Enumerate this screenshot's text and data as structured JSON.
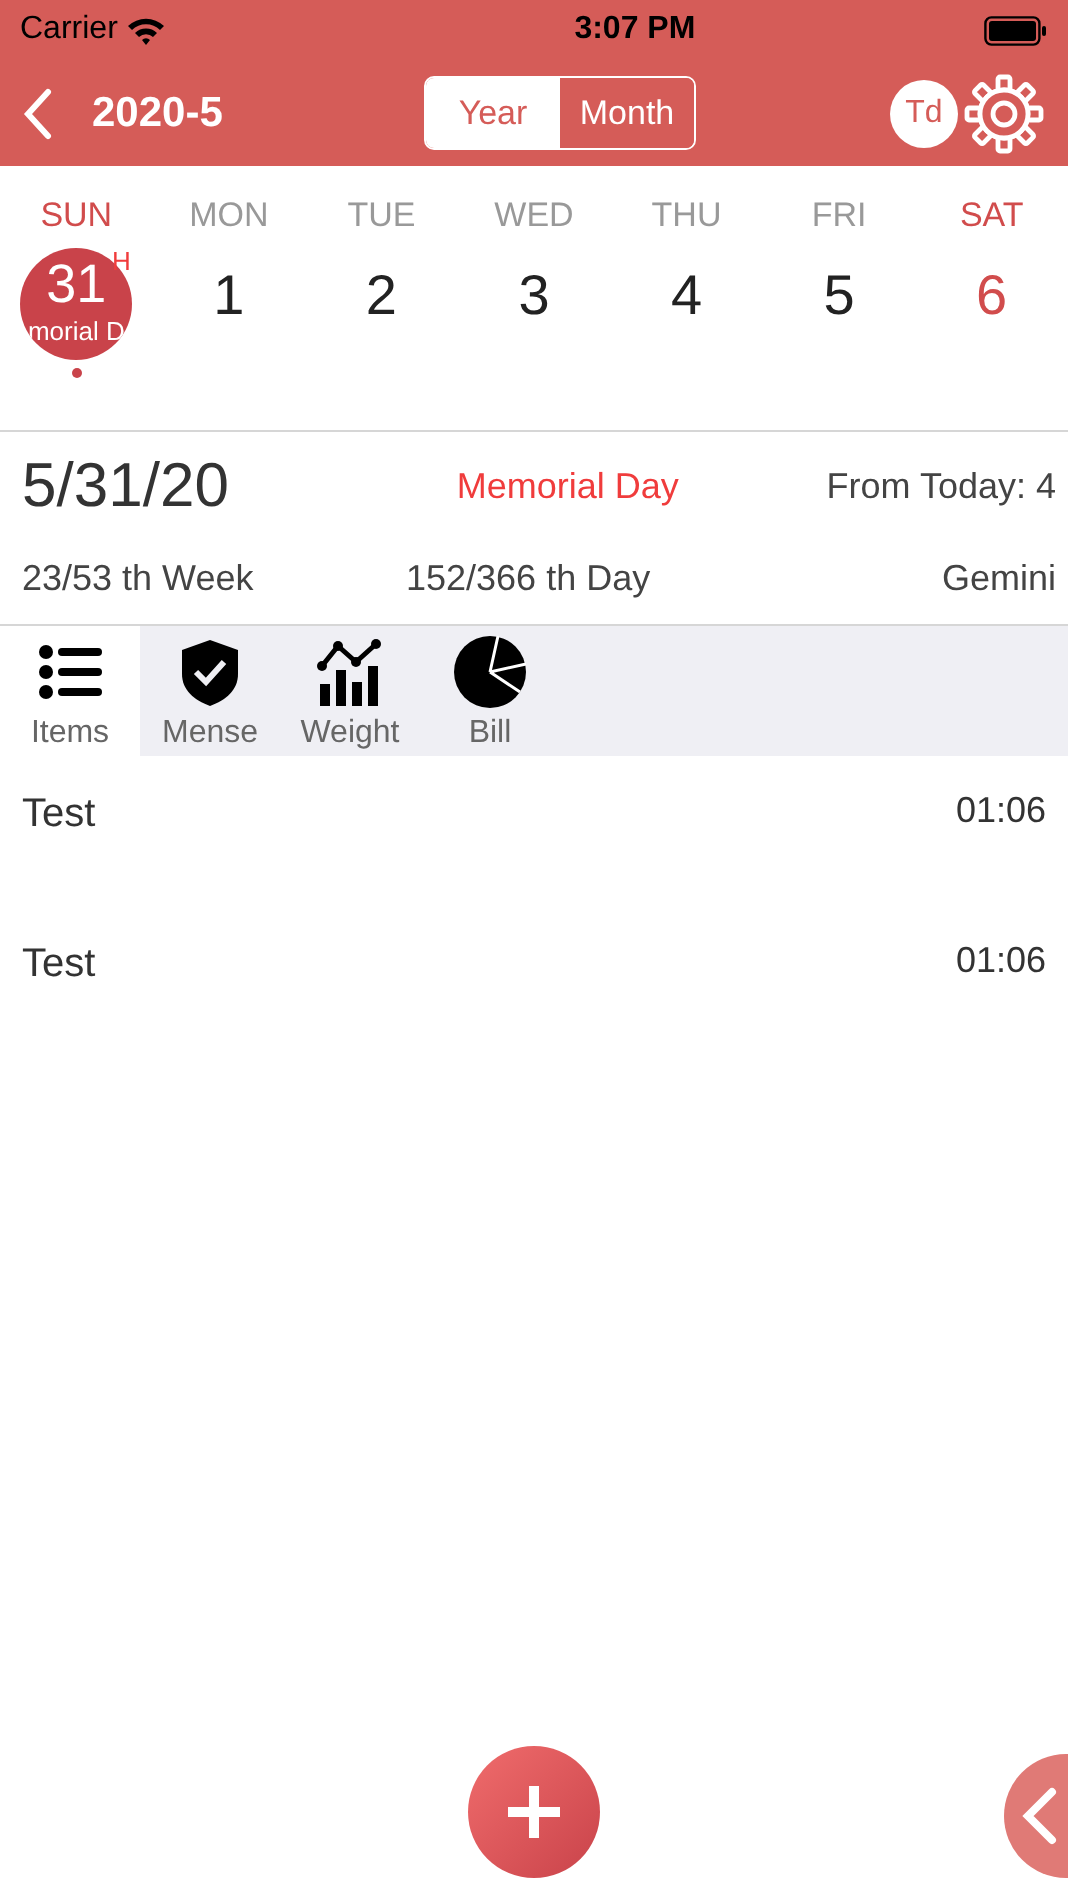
{
  "status_bar": {
    "carrier": "Carrier",
    "time": "3:07 PM"
  },
  "header": {
    "title": "2020-5",
    "segments": [
      {
        "label": "Year",
        "selected": false
      },
      {
        "label": "Month",
        "selected": true
      }
    ],
    "today_button": "Td"
  },
  "weekdays": [
    {
      "label": "SUN",
      "weekend": true
    },
    {
      "label": "MON",
      "weekend": false
    },
    {
      "label": "TUE",
      "weekend": false
    },
    {
      "label": "WED",
      "weekend": false
    },
    {
      "label": "THU",
      "weekend": false
    },
    {
      "label": "FRI",
      "weekend": false
    },
    {
      "label": "SAT",
      "weekend": true
    }
  ],
  "days": [
    {
      "label": "31",
      "weekend": true,
      "selected": true,
      "note": "morial D",
      "badge": "H",
      "event": true
    },
    {
      "label": "1",
      "weekend": false,
      "selected": false,
      "event": false
    },
    {
      "label": "2",
      "weekend": false,
      "selected": false,
      "event": false
    },
    {
      "label": "3",
      "weekend": false,
      "selected": false,
      "event": false
    },
    {
      "label": "4",
      "weekend": false,
      "selected": false,
      "event": false
    },
    {
      "label": "5",
      "weekend": false,
      "selected": false,
      "event": false
    },
    {
      "label": "6",
      "weekend": true,
      "selected": false,
      "event": false
    }
  ],
  "info": {
    "date": "5/31/20",
    "holiday": "Memorial Day",
    "from_today": "From Today: 4",
    "week": "23/53 th Week",
    "day_of_year": "152/366 th Day",
    "zodiac": "Gemini"
  },
  "tabs": [
    {
      "label": "Items",
      "kind": "list",
      "selected": true
    },
    {
      "label": "Mense",
      "kind": "shield",
      "selected": false
    },
    {
      "label": "Weight",
      "kind": "chart",
      "selected": false
    },
    {
      "label": "Bill",
      "kind": "pie",
      "selected": false
    }
  ],
  "items": [
    {
      "title": "Test",
      "time": "01:06"
    },
    {
      "title": "Test",
      "time": "01:06"
    }
  ]
}
